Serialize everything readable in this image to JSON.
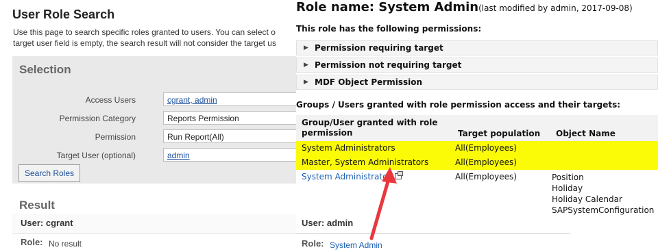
{
  "left_panel": {
    "title": "User Role Search",
    "description_line1": "Use this page to search specific roles granted to users. You can select o",
    "description_line2": "target user field is empty, the search result will not consider the target us",
    "selection": {
      "title": "Selection",
      "access_users": {
        "label": "Access Users",
        "value": "cgrant, admin"
      },
      "permission_category": {
        "label": "Permission Category",
        "value": "Reports Permission"
      },
      "permission": {
        "label": "Permission",
        "value": "Run Report(All)"
      },
      "target_user": {
        "label": "Target User (optional)",
        "value": "admin"
      },
      "search_button": "Search Roles"
    },
    "result": {
      "title": "Result",
      "user_label": "User: cgrant",
      "role_label": "Role:",
      "role_value": "No result"
    }
  },
  "right_panel": {
    "role_name": "Role name: System Admin",
    "role_meta": "(last modified by admin, 2017-09-08)",
    "permissions_intro": "This role has the following permissions:",
    "permission_sections": [
      "Permission requiring target",
      "Permission not requiring target",
      "MDF Object Permission"
    ],
    "groups_intro": "Groups / Users granted with role permission access and their targets:",
    "table": {
      "headers": [
        "Group/User granted with role permission",
        "Target population",
        "Object Name"
      ],
      "rows": [
        {
          "group": "System Administrators",
          "target": "All(Employees)",
          "objects": [],
          "highlighted": true
        },
        {
          "group": "Master, System Administrators",
          "target": "All(Employees)",
          "objects": [],
          "highlighted": true
        },
        {
          "group": "System Administrato",
          "target": "All(Employees)",
          "objects": [
            "Position",
            "Holiday",
            "Holiday Calendar",
            "SAPSystemConfiguration"
          ],
          "highlighted": false
        }
      ]
    },
    "result": {
      "user_label": "User: admin",
      "role_label": "Role:",
      "role_value": "System Admin"
    }
  },
  "colors": {
    "highlight": "#fbfb08",
    "link": "#1a5fb4",
    "arrow": "#e8383d",
    "selection_bg": "#e9e9e9"
  },
  "icons": {
    "expand": "triangle-right-icon",
    "external": "external-window-icon"
  }
}
